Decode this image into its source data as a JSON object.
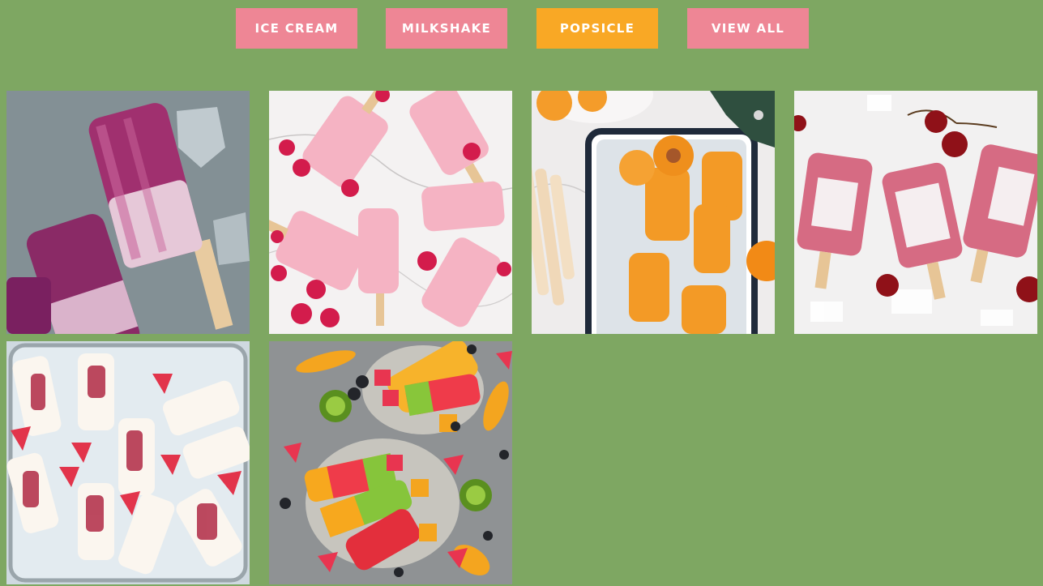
{
  "filters": [
    {
      "label": "ICE CREAM",
      "active": false
    },
    {
      "label": "MILKSHAKE",
      "active": false
    },
    {
      "label": "POPSICLE",
      "active": true
    },
    {
      "label": "VIEW ALL",
      "active": false
    }
  ],
  "colors": {
    "background": "#7ea762",
    "button_default": "#ee8695",
    "button_active": "#f9a825",
    "button_text": "#ffffff"
  },
  "gallery": {
    "category": "popsicle",
    "items": [
      {
        "subject": "purple berry popsicles on ice"
      },
      {
        "subject": "pink raspberry popsicles on marble"
      },
      {
        "subject": "apricot popsicles on tray"
      },
      {
        "subject": "cherry yogurt popsicles on ice"
      },
      {
        "subject": "strawberry cream popsicles in glass dish"
      },
      {
        "subject": "rainbow fruit popsicles with kiwi and mango"
      }
    ]
  }
}
